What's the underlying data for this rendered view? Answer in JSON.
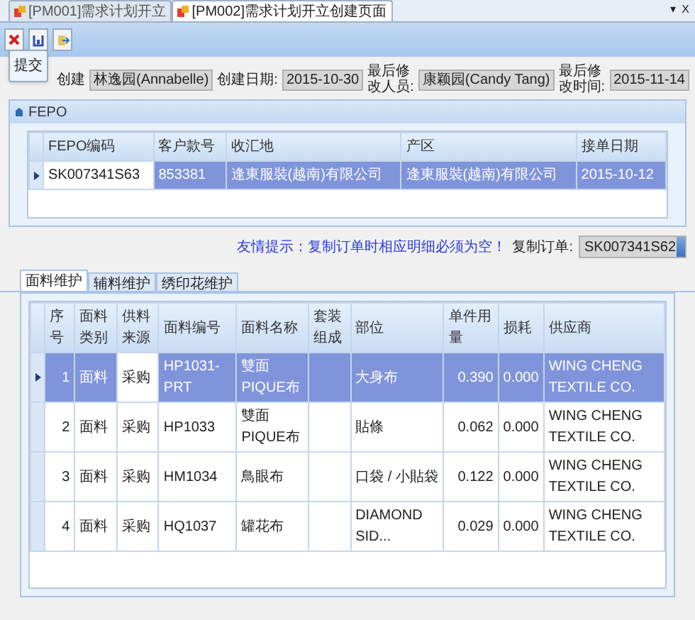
{
  "doc_tabs": [
    {
      "label": "[PM001]需求计划开立",
      "selected": false
    },
    {
      "label": "[PM002]需求计划开立创建页面",
      "selected": true
    }
  ],
  "tab_strip_controls": {
    "menu": "▾",
    "close": "X"
  },
  "toolbar": {
    "tooltip": "提交"
  },
  "header_fields": [
    {
      "label": "创建",
      "value": "林逸园(Annabelle)"
    },
    {
      "label": "创建日期:",
      "value": "2015-10-30"
    },
    {
      "label": "最后修改人员:",
      "value": "康颖园(Candy Tang)"
    },
    {
      "label": "最后修改时间:",
      "value": "2015-11-14"
    }
  ],
  "fepo_panel": {
    "title": "FEPO",
    "columns": [
      "FEPO编码",
      "客户款号",
      "收汇地",
      "产区",
      "接单日期"
    ],
    "rows": [
      {
        "selected": true,
        "cells": [
          "SK007341S63",
          "853381",
          "逢東服裝(越南)有限公司",
          "逢東服裝(越南)有限公司",
          "2015-10-12"
        ]
      }
    ]
  },
  "hint": "友情提示：复制订单时相应明细必须为空！",
  "copy_order": {
    "label": "复制订单:",
    "value": "SK007341S62"
  },
  "sub_tabs": [
    {
      "label": "面料维护",
      "selected": true
    },
    {
      "label": "辅料维护",
      "selected": false
    },
    {
      "label": "绣印花维护",
      "selected": false
    }
  ],
  "grid": {
    "columns": [
      "序号",
      "面料类别",
      "供料来源",
      "面料编号",
      "面料名称",
      "套装组成",
      "部位",
      "单件用量",
      "损耗",
      "供应商"
    ],
    "rows": [
      {
        "selected": true,
        "cells": [
          "1",
          "面料",
          "采购",
          "HP1031-PRT",
          "雙面PIQUE布",
          "",
          "大身布",
          "0.390",
          "0.000",
          "WING CHENG TEXTILE CO."
        ]
      },
      {
        "selected": false,
        "cells": [
          "2",
          "面料",
          "采购",
          "HP1033",
          "雙面PIQUE布",
          "",
          "貼條",
          "0.062",
          "0.000",
          "WING CHENG TEXTILE CO."
        ]
      },
      {
        "selected": false,
        "cells": [
          "3",
          "面料",
          "采购",
          "HM1034",
          "鳥眼布",
          "",
          "口袋 / 小貼袋",
          "0.122",
          "0.000",
          "WING CHENG TEXTILE CO."
        ]
      },
      {
        "selected": false,
        "cells": [
          "4",
          "面料",
          "采购",
          "HQ1037",
          "罐花布",
          "",
          "DIAMOND SID...",
          "0.029",
          "0.000",
          "WING CHENG TEXTILE CO."
        ]
      }
    ]
  }
}
